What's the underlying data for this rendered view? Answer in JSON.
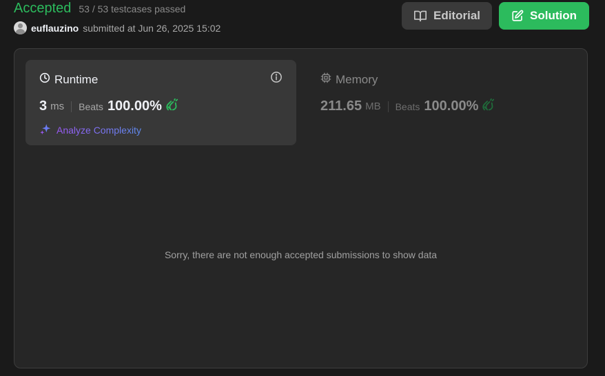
{
  "status": {
    "title": "Accepted",
    "testcases": "53 / 53 testcases passed",
    "title_color": "#2cbb5d"
  },
  "submission": {
    "username": "euflauzino",
    "submitted_text": "submitted at Jun 26, 2025 15:02"
  },
  "actions": {
    "editorial_label": "Editorial",
    "solution_label": "Solution",
    "solution_color": "#2cbb5d"
  },
  "runtime": {
    "label": "Runtime",
    "value": "3",
    "unit": "ms",
    "beats_label": "Beats",
    "beats_value": "100.00%",
    "analyze_label": "Analyze Complexity",
    "icons": [
      "clock-icon",
      "info-icon",
      "clap-icon",
      "sparkle-icon"
    ]
  },
  "memory": {
    "label": "Memory",
    "value": "211.65",
    "unit": "MB",
    "beats_label": "Beats",
    "beats_value": "100.00%",
    "icons": [
      "chip-icon",
      "clap-icon"
    ]
  },
  "chart": {
    "empty_message": "Sorry, there are not enough accepted submissions to show data"
  }
}
